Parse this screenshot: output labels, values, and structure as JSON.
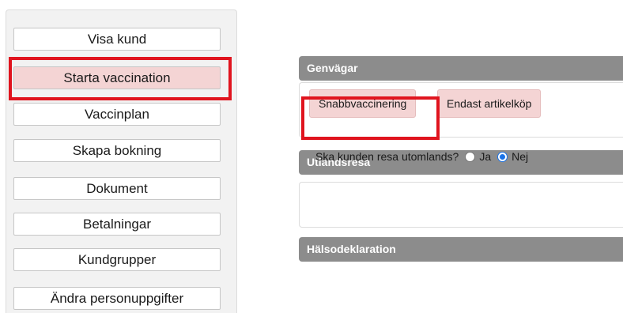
{
  "left_menu": {
    "items": [
      {
        "label": "Visa kund"
      },
      {
        "label": "Starta vaccination"
      },
      {
        "label": "Vaccinplan"
      },
      {
        "label": "Skapa bokning"
      },
      {
        "label": "Dokument"
      },
      {
        "label": "Betalningar"
      },
      {
        "label": "Kundgrupper"
      },
      {
        "label": "Ändra personuppgifter"
      }
    ]
  },
  "right_panel": {
    "shortcuts": {
      "header": "Genvägar",
      "buttons": [
        {
          "label": "Snabbvaccinering"
        },
        {
          "label": "Endast artikelköp"
        }
      ]
    },
    "travel": {
      "header": "Utlandsresa",
      "question": "Ska kunden resa utomlands?",
      "options": [
        {
          "label": "Ja",
          "checked": false
        },
        {
          "label": "Nej",
          "checked": true
        }
      ]
    },
    "health": {
      "header": "Hälsodeklaration"
    }
  },
  "colors": {
    "highlight": "#e0141e",
    "header_bg": "#8c8c8c",
    "selected_btn": "#f4d4d4",
    "radio_checked": "#1a73e8"
  }
}
